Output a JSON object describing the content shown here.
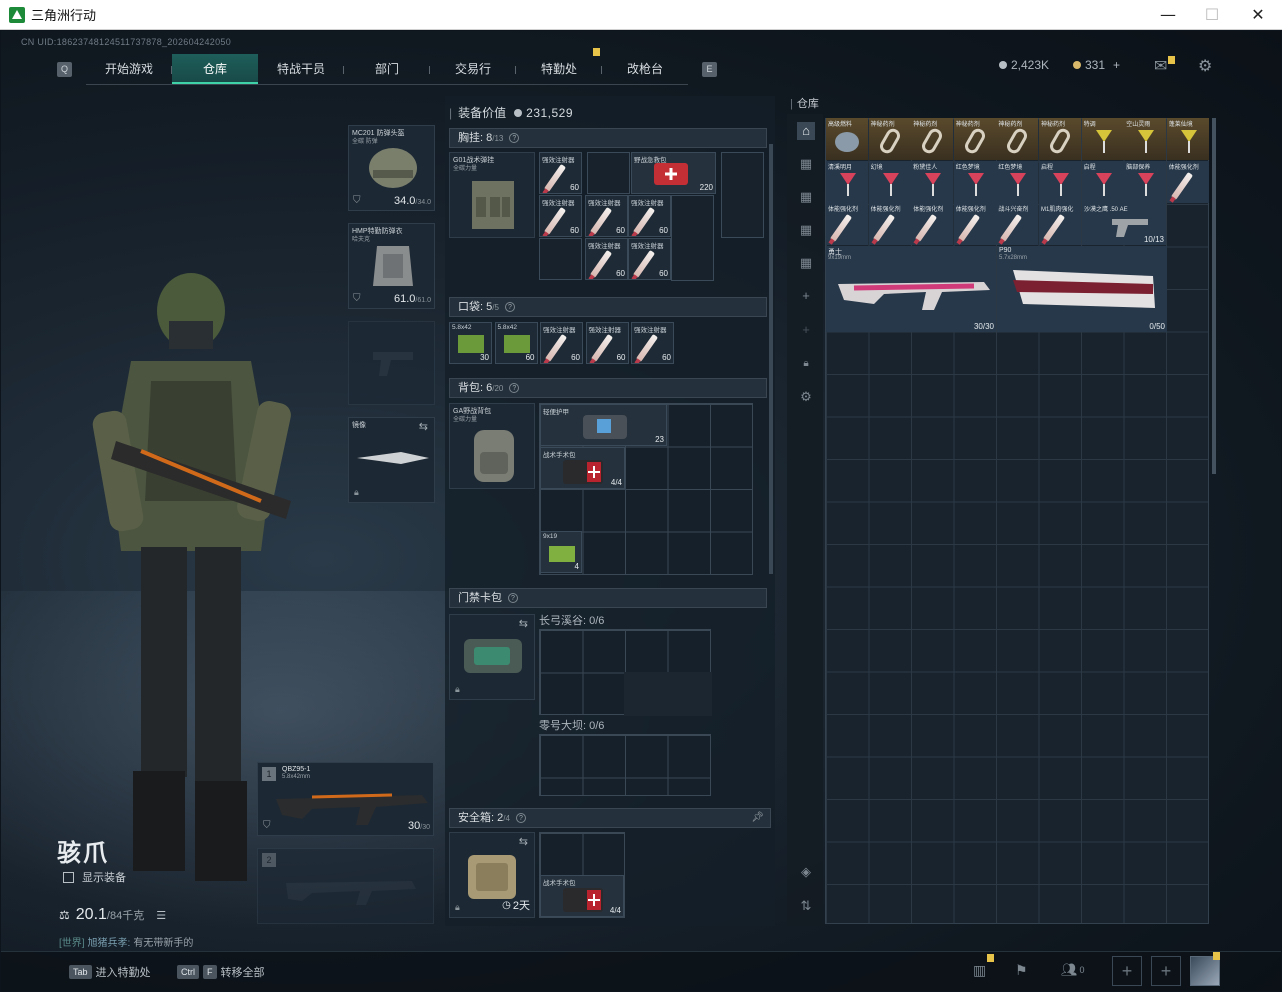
{
  "window": {
    "title": "三角洲行动",
    "minimize": "—",
    "maximize": "☐",
    "close": "✕"
  },
  "uid": "CN UID:18623748124511737878_202604242050",
  "nav": {
    "left_key": "Q",
    "right_key": "E",
    "tabs": [
      {
        "label": "开始游戏",
        "active": false
      },
      {
        "label": "仓库",
        "active": true
      },
      {
        "label": "特战干员",
        "active": false
      },
      {
        "label": "部门",
        "active": false
      },
      {
        "label": "交易行",
        "active": false
      },
      {
        "label": "特勤处",
        "active": false,
        "badge": true
      },
      {
        "label": "改枪台",
        "active": false
      }
    ]
  },
  "currency": {
    "silver": "2,423K",
    "gold": "331",
    "add": "+"
  },
  "operator": {
    "name": "骇爪",
    "show_gear_label": "显示装备",
    "weight": "20.1",
    "weight_max": "/84千克",
    "chat": {
      "channel": "[世界]",
      "user": "旭猪兵孝:",
      "message": "有无带新手的"
    }
  },
  "gear_slots": {
    "helmet": {
      "name": "MC201 防弹头盔",
      "sub": "全碳 防弹",
      "durability": "34.0",
      "max": "/34.0"
    },
    "armor": {
      "name": "HMP特勤防弹衣",
      "sub": "哈夫克",
      "durability": "61.0",
      "max": "/61.0"
    },
    "melee": {
      "name": "镜像"
    }
  },
  "weapons": {
    "primary": {
      "slot": "1",
      "name": "QBZ95-1",
      "caliber": "5.8x42mm",
      "ammo": "30",
      "ammo_max": "/30"
    },
    "secondary": {
      "slot": "2"
    }
  },
  "equipment": {
    "value_label": "装备价值",
    "value": "231,529",
    "chest_rig": {
      "label": "胸挂:",
      "count": "8",
      "max": "/13",
      "name": "G01战术弹挂",
      "sub": "全碳力量",
      "items": [
        {
          "name": "强效注射器",
          "count": "60"
        },
        {
          "name": "强效注射器",
          "count": "60"
        },
        {
          "name": "强效注射器",
          "count": "60"
        },
        {
          "name": "强效注射器",
          "count": "60"
        },
        {
          "name": "强效注射器",
          "count": "60"
        },
        {
          "name": "强效注射器",
          "count": "60"
        },
        {
          "name": "野战急救包",
          "count": "220"
        }
      ]
    },
    "pockets": {
      "label": "口袋:",
      "count": "5",
      "max": "/5",
      "items": [
        {
          "name": "5.8x42",
          "count": "30"
        },
        {
          "name": "5.8x42",
          "count": "60"
        },
        {
          "name": "强效注射器",
          "count": "60"
        },
        {
          "name": "强效注射器",
          "count": "60"
        },
        {
          "name": "强效注射器",
          "count": "60"
        }
      ]
    },
    "backpack": {
      "label": "背包:",
      "count": "6",
      "max": "/20",
      "name": "GA野战背包",
      "sub": "全碳力量",
      "items": [
        {
          "name": "轻便护甲",
          "count": "23"
        },
        {
          "name": "战术手术包",
          "count": "4/4"
        },
        {
          "name": "9x19",
          "count": "4"
        }
      ]
    },
    "keycard": {
      "label": "门禁卡包",
      "areas": [
        {
          "label": "长弓溪谷: 0/6"
        },
        {
          "label": "零号大坝: 0/6"
        }
      ]
    },
    "safe": {
      "label": "安全箱:",
      "count": "2",
      "max": "/4",
      "timer": "2天",
      "items": [
        {
          "name": "战术手术包",
          "count": "4/4"
        }
      ]
    }
  },
  "warehouse": {
    "label": "仓库",
    "row1": [
      "高级燃料",
      "神秘药剂",
      "神秘药剂",
      "神秘药剂",
      "神秘药剂",
      "神秘药剂",
      "特调",
      "空山灵雨",
      "蓬莱仙境"
    ],
    "row2": [
      "清溪明月",
      "幻境",
      "粉黛佳人",
      "红色梦境",
      "红色梦境",
      "启程",
      "启程",
      "脑部保养",
      "体能强化剂"
    ],
    "row3": [
      "体能强化剂",
      "体能强化剂",
      "体能强化剂",
      "体能强化剂",
      "战斗兴奋剂",
      "M1肌肉强化",
      "沙漠之鹰 .50 AE"
    ],
    "deagle_ammo": "10/13",
    "gun1": {
      "name": "勇士",
      "caliber": "9x19mm",
      "ammo": "30/30"
    },
    "gun2": {
      "name": "P90",
      "caliber": "5.7x28mm",
      "ammo": "0/50"
    }
  },
  "bottom": {
    "tab_key": "Tab",
    "tab_label": "进入特勤处",
    "ctrl_key": "Ctrl",
    "f_key": "F",
    "transfer_label": "转移全部",
    "friends": "0"
  },
  "colors": {
    "accent": "#3fd2a8",
    "tab_active": "#1e5e5a",
    "badge": "#e8c34a"
  }
}
